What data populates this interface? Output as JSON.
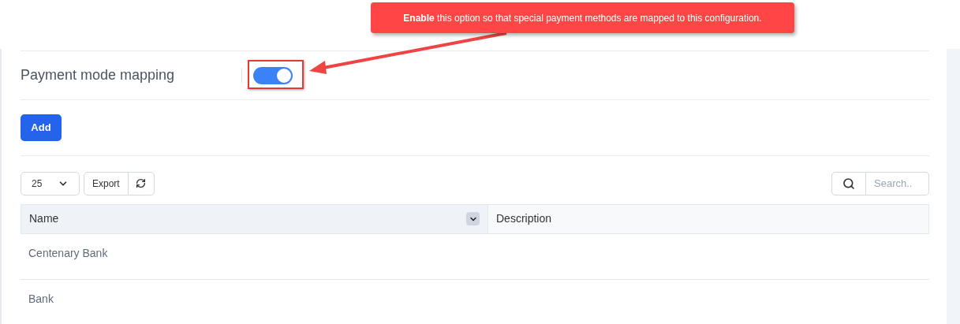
{
  "callout": {
    "text": "**Enable** this option so that special payment methods are mapped to this configuration."
  },
  "setting": {
    "label": "Payment mode mapping",
    "on": true
  },
  "add_button": "Add",
  "toolbar": {
    "page_size": "25",
    "export": "Export",
    "search": {
      "placeholder": "Search.."
    }
  },
  "table": {
    "columns": [
      {
        "label": "Name",
        "sortable": true
      },
      {
        "label": "Description",
        "sortable": false
      }
    ],
    "rows": [
      {
        "name": "Centenary Bank"
      },
      {
        "name": "Bank"
      }
    ]
  }
}
